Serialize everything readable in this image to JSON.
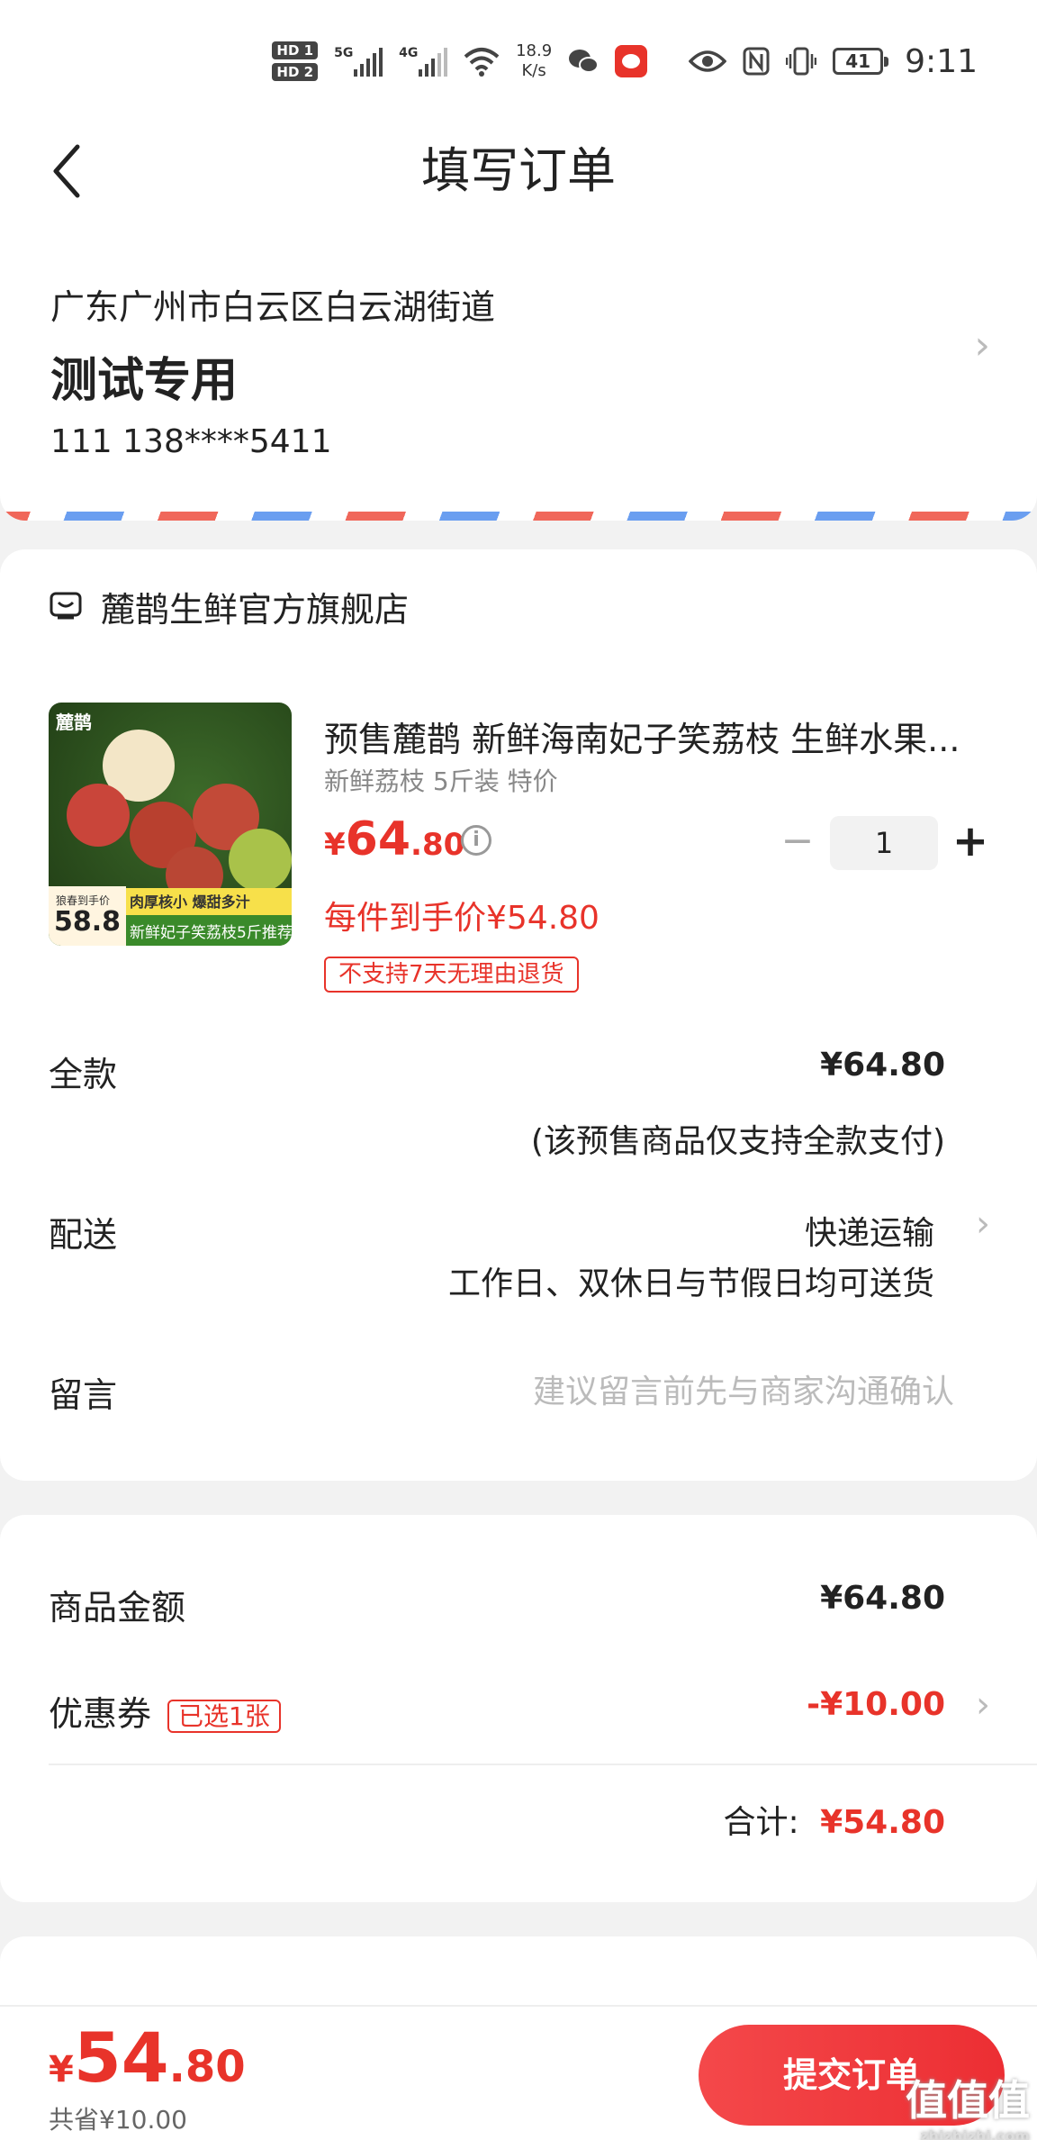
{
  "status_bar": {
    "hd1": "HD 1",
    "hd2": "HD 2",
    "sig1": "5G",
    "sig2": "4G",
    "speed_value": "18.9",
    "speed_unit": "K/s",
    "battery": "41",
    "time": "9:11"
  },
  "header": {
    "title": "填写订单"
  },
  "address": {
    "line": "广东广州市白云区白云湖街道",
    "name": "测试专用",
    "phone": "111  138****5411"
  },
  "store": {
    "name": "麓鹊生鲜官方旗舰店"
  },
  "product": {
    "image_brand": "麓鹊",
    "image_price": "58.8",
    "image_tag": "狼春到手价",
    "image_band_top": "肉厚核小 爆甜多汁",
    "image_band_bottom": "新鲜妃子笑荔枝5斤推荐",
    "title": "预售麓鹊 新鲜海南妃子笑荔枝 生鲜水果...",
    "spec": "新鲜荔枝 5斤装 特价",
    "price_symbol": "¥",
    "price_int": "64",
    "price_dec": ".80",
    "deal_price": "每件到手价¥54.80",
    "return_tag": "不支持7天无理由退货",
    "quantity": "1"
  },
  "payment": {
    "label": "全款",
    "amount": "¥64.80",
    "note": "(该预售商品仅支持全款支付)"
  },
  "delivery": {
    "label": "配送",
    "method": "快递运输",
    "note": "工作日、双休日与节假日均可送货"
  },
  "message": {
    "label": "留言",
    "placeholder": "建议留言前先与商家沟通确认"
  },
  "summary": {
    "goods_label": "商品金额",
    "goods_amount": "¥64.80",
    "coupon_label": "优惠券",
    "coupon_tag": "已选1张",
    "coupon_amount": "-¥10.00",
    "total_label": "合计:",
    "total_amount": "¥54.80"
  },
  "bottom": {
    "symbol": "¥",
    "total_int": "54",
    "total_dec": ".80",
    "saved": "共省¥10.00",
    "submit": "提交订单"
  },
  "watermark": {
    "text": "值值值",
    "sub": "zhizhizhi.com"
  },
  "colors": {
    "accent": "#e8332a",
    "background": "#f2f2f2"
  }
}
